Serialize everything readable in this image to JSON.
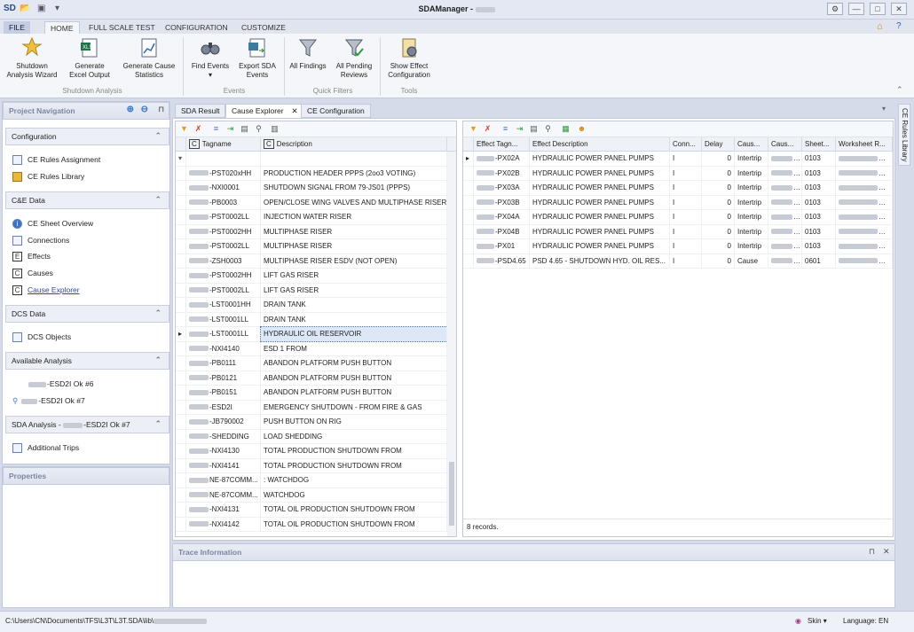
{
  "window": {
    "title": "SDAManager - ",
    "quick_access": [
      "SD",
      "📂",
      "💾",
      "▾"
    ],
    "controls": [
      "⚙",
      "—",
      "□",
      "✕"
    ]
  },
  "ribbon": {
    "tabs": [
      "FILE",
      "HOME",
      "FULL SCALE TEST",
      "CONFIGURATION",
      "CUSTOMIZE"
    ],
    "buttons": [
      {
        "line1": "Shutdown",
        "line2": "Analysis Wizard"
      },
      {
        "line1": "Generate",
        "line2": "Excel Output"
      },
      {
        "line1": "Generate Cause",
        "line2": "Statistics"
      },
      {
        "line1": "Find Events",
        "line2": "▾"
      },
      {
        "line1": "Export SDA",
        "line2": "Events"
      },
      {
        "line1": "All Findings",
        "line2": ""
      },
      {
        "line1": "All Pending",
        "line2": "Reviews"
      },
      {
        "line1": "Show Effect",
        "line2": "Configuration"
      }
    ],
    "groups": [
      "Shutdown Analysis",
      "Events",
      "Quick Filters",
      "Tools"
    ]
  },
  "nav": {
    "title": "Project Navigation",
    "sections": [
      {
        "label": "Configuration",
        "items": [
          "CE Rules Assignment",
          "CE Rules Library"
        ]
      },
      {
        "label": "C&E Data",
        "items": [
          "CE Sheet Overview",
          "Connections",
          "Effects",
          "Causes",
          "Cause Explorer"
        ]
      },
      {
        "label": "DCS Data",
        "items": [
          "DCS Objects"
        ]
      },
      {
        "label": "Available Analysis",
        "items": [
          "-ESD2I Ok #6",
          "-ESD2I Ok #7"
        ]
      },
      {
        "label": "SDA Analysis - ",
        "label_suffix": "-ESD2I Ok #7",
        "items": [
          "Additional Trips"
        ]
      }
    ],
    "properties_title": "Properties"
  },
  "doc_tabs": [
    "SDA Result",
    "Cause Explorer",
    "CE Configuration"
  ],
  "cause_grid": {
    "headers": [
      "Tagname",
      "Description"
    ],
    "rows": [
      [
        "-PST020xHH",
        "PRODUCTION HEADER PPPS (2oo3 VOTING)"
      ],
      [
        "-NXI0001",
        "SHUTDOWN SIGNAL FROM 79-JS01 (PPPS)"
      ],
      [
        "-PB0003",
        "OPEN/CLOSE WING VALVES AND MULTIPHASE RISER"
      ],
      [
        "-PST0002LL",
        "INJECTION  WATER RISER"
      ],
      [
        "-PST0002HH",
        "MULTIPHASE RISER"
      ],
      [
        "-PST0002LL",
        "MULTIPHASE RISER"
      ],
      [
        "-ZSH0003",
        "MULTIPHASE RISER ESDV (NOT OPEN)"
      ],
      [
        "-PST0002HH",
        "LIFT GAS RISER"
      ],
      [
        "-PST0002LL",
        "LIFT GAS RISER"
      ],
      [
        "-LST0001HH",
        "DRAIN TANK"
      ],
      [
        "-LST0001LL",
        "DRAIN TANK"
      ],
      [
        "-LST0001LL",
        "HYDRAULIC OIL RESERVOIR"
      ],
      [
        "-NXI4140",
        "ESD 1 FROM"
      ],
      [
        "-PB0111",
        "ABANDON PLATFORM PUSH BUTTON"
      ],
      [
        "-PB0121",
        "ABANDON PLATFORM PUSH BUTTON"
      ],
      [
        "-PB0151",
        "ABANDON PLATFORM PUSH BUTTON"
      ],
      [
        "-ESD2I",
        "EMERGENCY SHUTDOWN - FROM FIRE & GAS"
      ],
      [
        "-JB790002",
        "PUSH BUTTON ON RIG"
      ],
      [
        "-SHEDDING",
        "LOAD SHEDDING"
      ],
      [
        "-NXI4130",
        "TOTAL PRODUCTION SHUTDOWN FROM"
      ],
      [
        "-NXI4141",
        "TOTAL PRODUCTION SHUTDOWN FROM"
      ],
      [
        "NE-87COMM...",
        ": WATCHDOG"
      ],
      [
        "NE-87COMM...",
        "WATCHDOG"
      ],
      [
        "-NXI4131",
        "TOTAL OIL PRODUCTION SHUTDOWN FROM"
      ],
      [
        "-NXI4142",
        "TOTAL OIL PRODUCTION SHUTDOWN FROM"
      ]
    ]
  },
  "effect_grid": {
    "headers": [
      "Effect Tagn...",
      "Effect Description",
      "Conn...",
      "Delay",
      "Caus...",
      "Caus...",
      "Sheet...",
      "Worksheet R..."
    ],
    "rows": [
      [
        "-PX02A",
        "HYDRAULIC POWER PANEL PUMPS",
        "I",
        "0",
        "Intertrip",
        "",
        "0103",
        ""
      ],
      [
        "-PX02B",
        "HYDRAULIC POWER PANEL PUMPS",
        "I",
        "0",
        "Intertrip",
        "",
        "0103",
        ""
      ],
      [
        "-PX03A",
        "HYDRAULIC POWER PANEL PUMPS",
        "I",
        "0",
        "Intertrip",
        "",
        "0103",
        ""
      ],
      [
        "-PX03B",
        "HYDRAULIC POWER PANEL PUMPS",
        "I",
        "0",
        "Intertrip",
        "",
        "0103",
        ""
      ],
      [
        "-PX04A",
        "HYDRAULIC POWER PANEL PUMPS",
        "I",
        "0",
        "Intertrip",
        "",
        "0103",
        ""
      ],
      [
        "-PX04B",
        "HYDRAULIC POWER PANEL PUMPS",
        "I",
        "0",
        "Intertrip",
        "",
        "0103",
        ""
      ],
      [
        "-PX01",
        "HYDRAULIC POWER PANEL PUMPS",
        "I",
        "0",
        "Intertrip",
        "",
        "0103",
        ""
      ],
      [
        "-PSD4.65",
        "PSD 4.65 - SHUTDOWN HYD. OIL RES...",
        "I",
        "0",
        "Cause",
        "",
        "0601",
        ""
      ]
    ],
    "records": "8 records."
  },
  "trace": {
    "title": "Trace Information"
  },
  "side_tab": "CE Rules Library",
  "status": {
    "path": "C:\\Users\\CN\\Documents\\TFS\\L3T\\L3T.SDA\\lib\\",
    "skin": "Skin ▾",
    "language": "Language: EN"
  }
}
